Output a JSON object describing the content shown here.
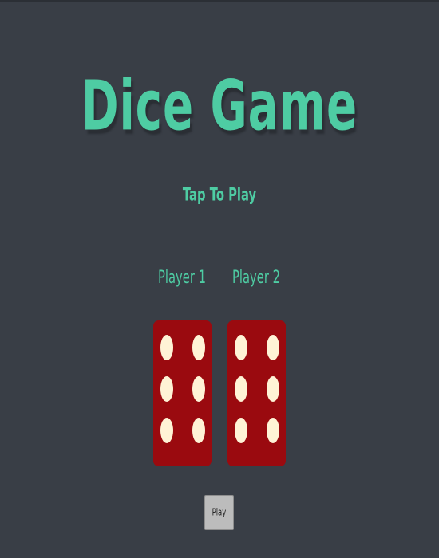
{
  "title": "Dice Game",
  "subtitle": "Tap To Play",
  "players": [
    {
      "label": "Player 1",
      "die_value": 6
    },
    {
      "label": "Player 2",
      "die_value": 6
    }
  ],
  "play_button": {
    "label": "Play"
  },
  "colors": {
    "background": "#393e46",
    "accent": "#4ecca3",
    "die": "#9a0a0f",
    "pip": "#fff3d6",
    "button": "#bcbcbc"
  },
  "icons": {
    "die": "dice-six-icon"
  }
}
